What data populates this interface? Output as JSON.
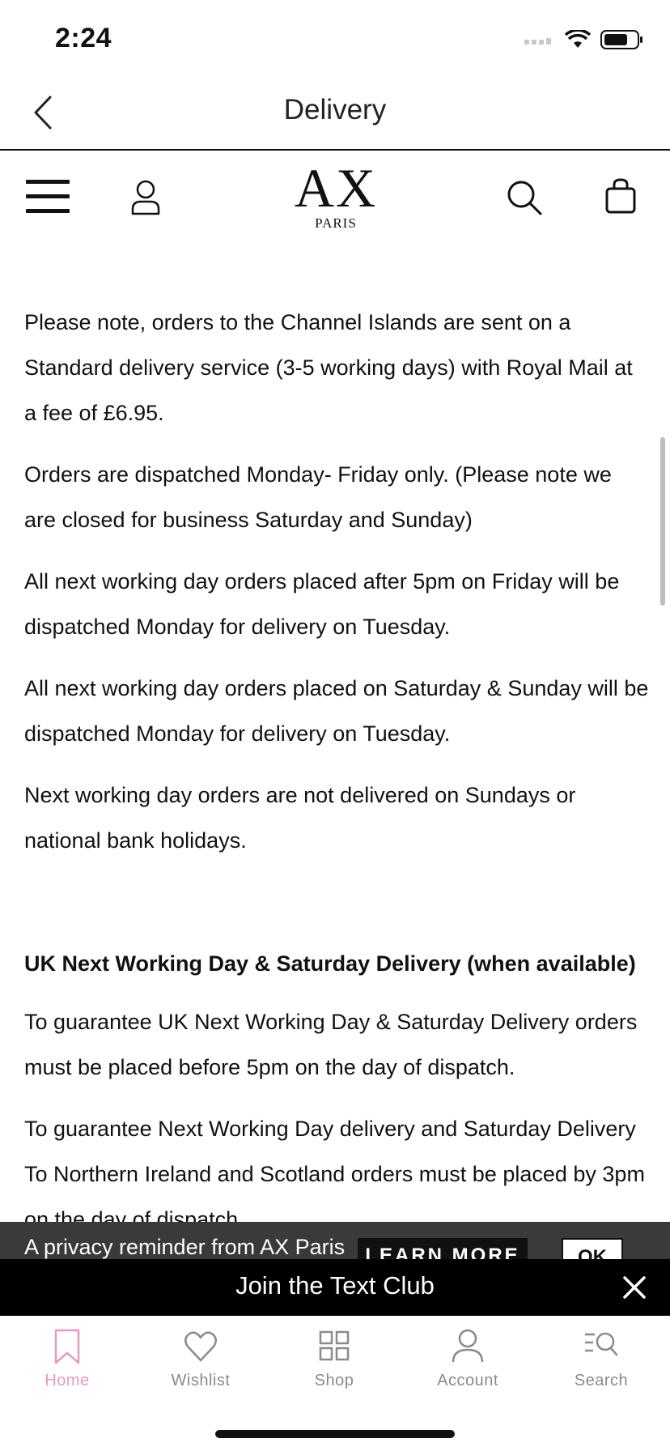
{
  "status_bar": {
    "time": "2:24"
  },
  "header": {
    "title": "Delivery"
  },
  "brand": {
    "logo": "AX",
    "sub": "PARIS"
  },
  "content": {
    "paragraphs_top": [
      "Please note, orders to the Channel Islands are sent on a Standard delivery service (3-5 working days) with Royal Mail at a fee of £6.95.",
      "Orders are dispatched Monday- Friday only. (Please note we are closed for business Saturday and Sunday)",
      "All next working day orders placed after 5pm on Friday will be dispatched Monday for delivery on Tuesday.",
      "All next working day orders placed on Saturday & Sunday will be dispatched Monday for delivery on Tuesday.",
      "Next working day orders are not delivered on Sundays or national bank holidays."
    ],
    "subheading": "UK Next Working Day & Saturday Delivery (when available)",
    "paragraphs_bottom": [
      "To guarantee UK Next Working Day & Saturday Delivery orders must be placed before 5pm on the day of dispatch.",
      "To guarantee Next Working Day delivery and Saturday Delivery To Northern Ireland and Scotland orders must be placed by 3pm on the day of dispatch."
    ]
  },
  "privacy_banner": {
    "text": "A privacy reminder from AX Paris",
    "learn_more": "LEARN MORE",
    "ok": "OK"
  },
  "text_club": {
    "label": "Join the Text Club"
  },
  "tabs": [
    {
      "label": "Home",
      "icon": "bookmark-icon",
      "active": true
    },
    {
      "label": "Wishlist",
      "icon": "heart-icon",
      "active": false
    },
    {
      "label": "Shop",
      "icon": "grid-icon",
      "active": false
    },
    {
      "label": "Account",
      "icon": "person-icon",
      "active": false
    },
    {
      "label": "Search",
      "icon": "search-list-icon",
      "active": false
    }
  ],
  "colors": {
    "active_tab": "#e79ac0",
    "inactive_tab": "#8a8a8a",
    "banner_bg": "#3a3a3a",
    "text_club_bg": "#000000"
  }
}
